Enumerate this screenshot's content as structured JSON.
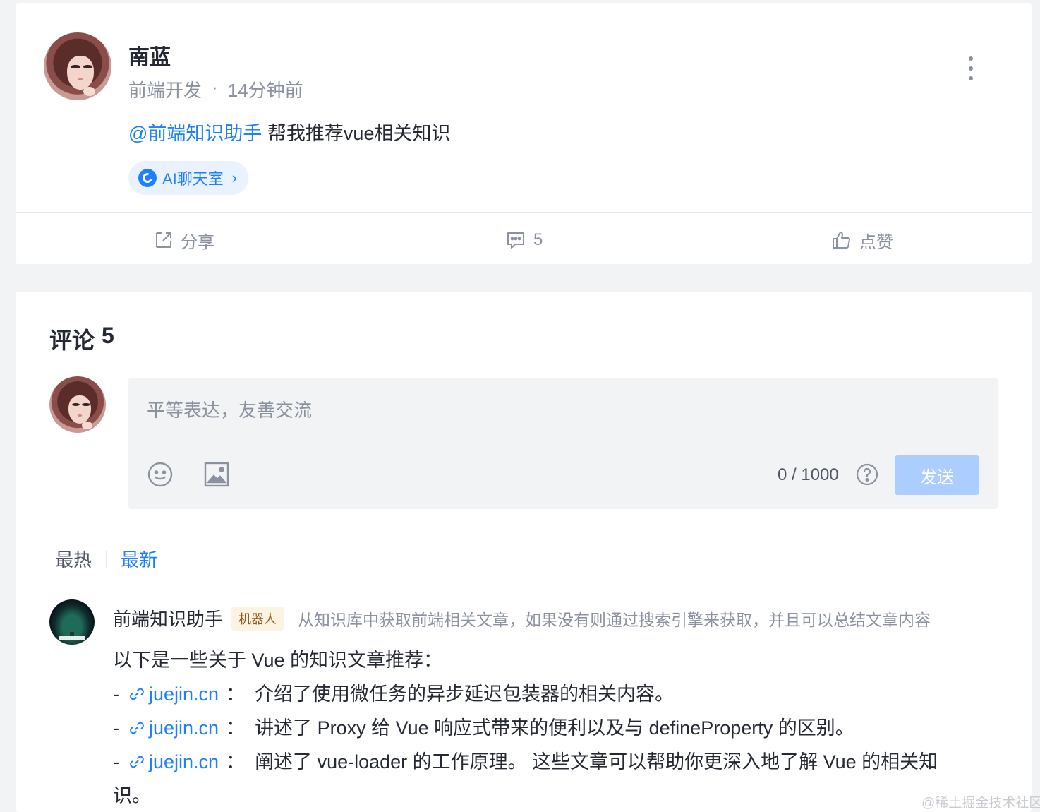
{
  "post": {
    "author": "南蓝",
    "job": "前端开发",
    "dot": "·",
    "time": "14分钟前",
    "mention": "@前端知识助手",
    "text": " 帮我推荐vue相关知识",
    "ai_pill": "AI聊天室",
    "actions": {
      "share": "分享",
      "comments": "5",
      "like": "点赞"
    }
  },
  "comments": {
    "title": "评论",
    "count": "5",
    "input_placeholder": "平等表达，友善交流",
    "char_count": "0 / 1000",
    "send_label": "发送",
    "tabs": {
      "hot": "最热",
      "new": "最新"
    }
  },
  "bot_comment": {
    "name": "前端知识助手",
    "badge": "机器人",
    "description": "从知识库中获取前端相关文章，如果没有则通过搜索引擎来获取，并且可以总结文章内容",
    "intro": "以下是一些关于 Vue 的知识文章推荐：",
    "items": [
      {
        "dash": "-",
        "link": "juejin.cn",
        "colon": "：",
        "text": "介绍了使用微任务的异步延迟包装器的相关内容。"
      },
      {
        "dash": "-",
        "link": "juejin.cn",
        "colon": "：",
        "text": "讲述了 Proxy 给 Vue 响应式带来的便利以及与 defineProperty 的区别。"
      },
      {
        "dash": "-",
        "link": "juejin.cn",
        "colon": "：",
        "text": "阐述了 vue-loader 的工作原理。 这些文章可以帮助你更深入地了解 Vue 的相关知"
      }
    ],
    "tail": "识。"
  },
  "watermark": "@稀土掘金技术社区",
  "colors": {
    "accent": "#1e80ff",
    "muted": "#8a919f",
    "send_disabled": "#abcdff"
  },
  "icons": [
    "more-icon",
    "ai-icon",
    "chevron-right-icon",
    "share-icon",
    "comment-icon",
    "like-icon",
    "emoji-icon",
    "image-icon",
    "help-icon",
    "link-icon"
  ]
}
